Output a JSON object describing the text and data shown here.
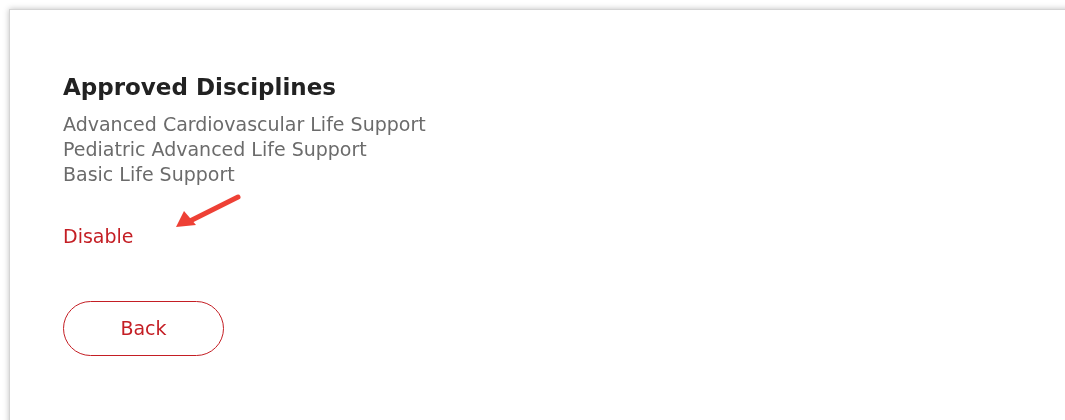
{
  "title": "Approved Disciplines",
  "disciplines": [
    "Advanced Cardiovascular Life Support",
    "Pediatric Advanced Life Support",
    "Basic Life Support"
  ],
  "disable_link": "Disable",
  "back_button": "Back"
}
